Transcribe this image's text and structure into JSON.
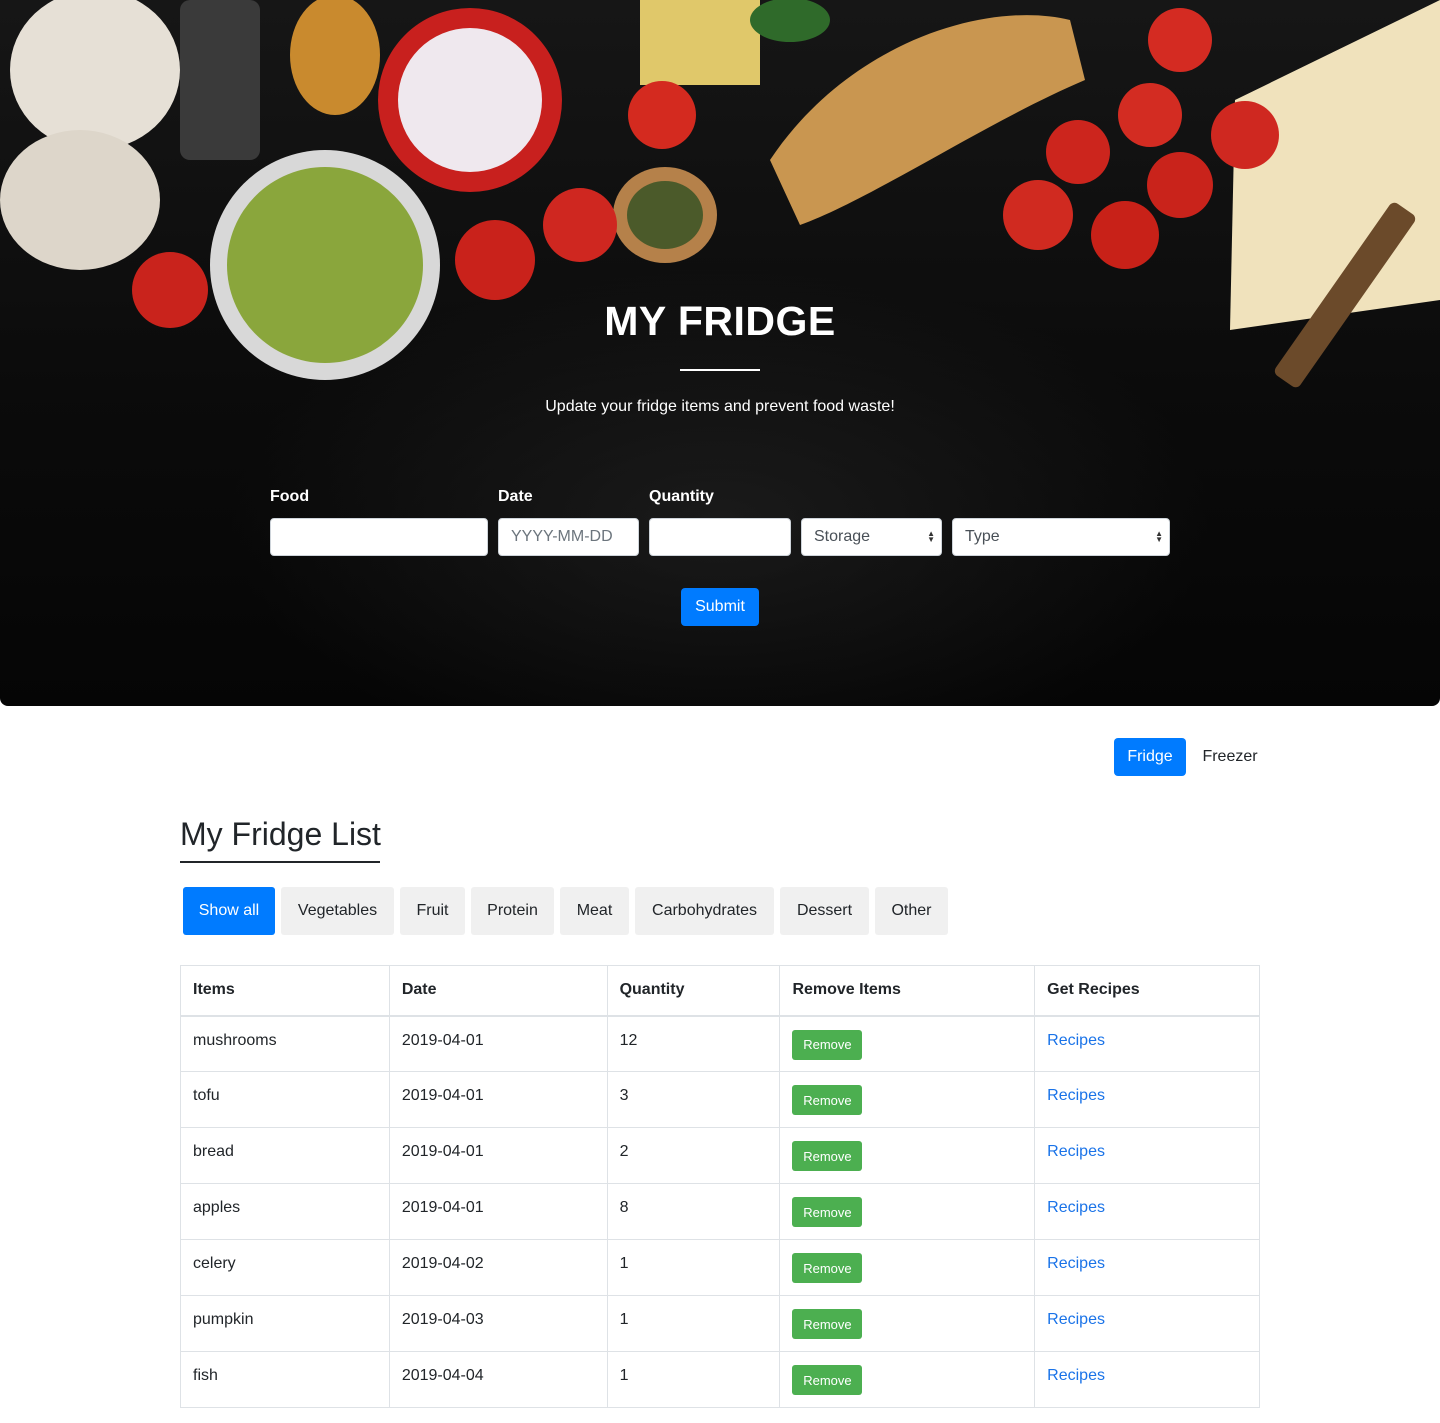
{
  "hero": {
    "title": "MY FRIDGE",
    "subtitle": "Update your fridge items and prevent food waste!"
  },
  "form": {
    "food_label": "Food",
    "food_value": "",
    "date_label": "Date",
    "date_placeholder": "YYYY-MM-DD",
    "quantity_label": "Quantity",
    "quantity_value": "",
    "storage_select": "Storage",
    "type_select": "Type",
    "submit_label": "Submit"
  },
  "storage_tabs": [
    {
      "label": "Fridge",
      "active": true
    },
    {
      "label": "Freezer",
      "active": false
    }
  ],
  "list": {
    "title": "My Fridge List",
    "filters": [
      "Show all",
      "Vegetables",
      "Fruit",
      "Protein",
      "Meat",
      "Carbohydrates",
      "Dessert",
      "Other"
    ],
    "active_filter": "Show all",
    "columns": [
      "Items",
      "Date",
      "Quantity",
      "Remove Items",
      "Get Recipes"
    ],
    "remove_label": "Remove",
    "recipes_label": "Recipes",
    "rows": [
      {
        "item": "mushrooms",
        "date": "2019-04-01",
        "quantity": "12"
      },
      {
        "item": "tofu",
        "date": "2019-04-01",
        "quantity": "3"
      },
      {
        "item": "bread",
        "date": "2019-04-01",
        "quantity": "2"
      },
      {
        "item": "apples",
        "date": "2019-04-01",
        "quantity": "8"
      },
      {
        "item": "celery",
        "date": "2019-04-02",
        "quantity": "1"
      },
      {
        "item": "pumpkin",
        "date": "2019-04-03",
        "quantity": "1"
      },
      {
        "item": "fish",
        "date": "2019-04-04",
        "quantity": "1"
      }
    ]
  },
  "colors": {
    "primary": "#007bff",
    "remove_green": "#4caf50",
    "link_blue": "#1a73e8",
    "hero_background": "#0b0b0b"
  }
}
